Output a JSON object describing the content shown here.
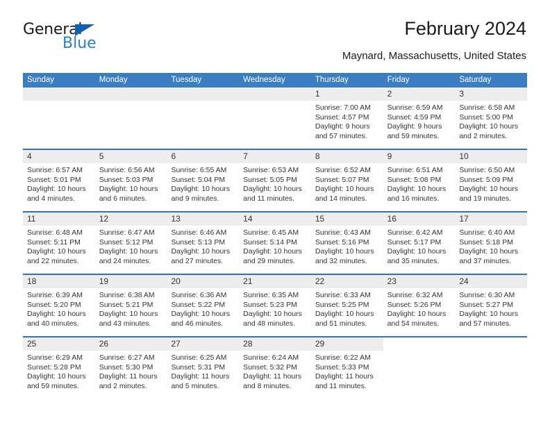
{
  "logo": {
    "word_one": "General",
    "word_two": "Blue",
    "triangle_color": "#1161ad",
    "blue_text_color": "#2a7fd4"
  },
  "header": {
    "title": "February 2024",
    "location": "Maynard, Massachusetts, United States"
  },
  "theme": {
    "header_blue": "#3a7dc0",
    "separator_blue": "#2f72b8",
    "daynum_band": "#ededed"
  },
  "weekdays": [
    "Sunday",
    "Monday",
    "Tuesday",
    "Wednesday",
    "Thursday",
    "Friday",
    "Saturday"
  ],
  "weeks": [
    [
      {
        "day": "",
        "empty": true
      },
      {
        "day": "",
        "empty": true
      },
      {
        "day": "",
        "empty": true
      },
      {
        "day": "",
        "empty": true
      },
      {
        "day": "1",
        "sunrise": "Sunrise: 7:00 AM",
        "sunset": "Sunset: 4:57 PM",
        "daylight": "Daylight: 9 hours and 57 minutes."
      },
      {
        "day": "2",
        "sunrise": "Sunrise: 6:59 AM",
        "sunset": "Sunset: 4:59 PM",
        "daylight": "Daylight: 9 hours and 59 minutes."
      },
      {
        "day": "3",
        "sunrise": "Sunrise: 6:58 AM",
        "sunset": "Sunset: 5:00 PM",
        "daylight": "Daylight: 10 hours and 2 minutes."
      }
    ],
    [
      {
        "day": "4",
        "sunrise": "Sunrise: 6:57 AM",
        "sunset": "Sunset: 5:01 PM",
        "daylight": "Daylight: 10 hours and 4 minutes."
      },
      {
        "day": "5",
        "sunrise": "Sunrise: 6:56 AM",
        "sunset": "Sunset: 5:03 PM",
        "daylight": "Daylight: 10 hours and 6 minutes."
      },
      {
        "day": "6",
        "sunrise": "Sunrise: 6:55 AM",
        "sunset": "Sunset: 5:04 PM",
        "daylight": "Daylight: 10 hours and 9 minutes."
      },
      {
        "day": "7",
        "sunrise": "Sunrise: 6:53 AM",
        "sunset": "Sunset: 5:05 PM",
        "daylight": "Daylight: 10 hours and 11 minutes."
      },
      {
        "day": "8",
        "sunrise": "Sunrise: 6:52 AM",
        "sunset": "Sunset: 5:07 PM",
        "daylight": "Daylight: 10 hours and 14 minutes."
      },
      {
        "day": "9",
        "sunrise": "Sunrise: 6:51 AM",
        "sunset": "Sunset: 5:08 PM",
        "daylight": "Daylight: 10 hours and 16 minutes."
      },
      {
        "day": "10",
        "sunrise": "Sunrise: 6:50 AM",
        "sunset": "Sunset: 5:09 PM",
        "daylight": "Daylight: 10 hours and 19 minutes."
      }
    ],
    [
      {
        "day": "11",
        "sunrise": "Sunrise: 6:48 AM",
        "sunset": "Sunset: 5:11 PM",
        "daylight": "Daylight: 10 hours and 22 minutes."
      },
      {
        "day": "12",
        "sunrise": "Sunrise: 6:47 AM",
        "sunset": "Sunset: 5:12 PM",
        "daylight": "Daylight: 10 hours and 24 minutes."
      },
      {
        "day": "13",
        "sunrise": "Sunrise: 6:46 AM",
        "sunset": "Sunset: 5:13 PM",
        "daylight": "Daylight: 10 hours and 27 minutes."
      },
      {
        "day": "14",
        "sunrise": "Sunrise: 6:45 AM",
        "sunset": "Sunset: 5:14 PM",
        "daylight": "Daylight: 10 hours and 29 minutes."
      },
      {
        "day": "15",
        "sunrise": "Sunrise: 6:43 AM",
        "sunset": "Sunset: 5:16 PM",
        "daylight": "Daylight: 10 hours and 32 minutes."
      },
      {
        "day": "16",
        "sunrise": "Sunrise: 6:42 AM",
        "sunset": "Sunset: 5:17 PM",
        "daylight": "Daylight: 10 hours and 35 minutes."
      },
      {
        "day": "17",
        "sunrise": "Sunrise: 6:40 AM",
        "sunset": "Sunset: 5:18 PM",
        "daylight": "Daylight: 10 hours and 37 minutes."
      }
    ],
    [
      {
        "day": "18",
        "sunrise": "Sunrise: 6:39 AM",
        "sunset": "Sunset: 5:20 PM",
        "daylight": "Daylight: 10 hours and 40 minutes."
      },
      {
        "day": "19",
        "sunrise": "Sunrise: 6:38 AM",
        "sunset": "Sunset: 5:21 PM",
        "daylight": "Daylight: 10 hours and 43 minutes."
      },
      {
        "day": "20",
        "sunrise": "Sunrise: 6:36 AM",
        "sunset": "Sunset: 5:22 PM",
        "daylight": "Daylight: 10 hours and 46 minutes."
      },
      {
        "day": "21",
        "sunrise": "Sunrise: 6:35 AM",
        "sunset": "Sunset: 5:23 PM",
        "daylight": "Daylight: 10 hours and 48 minutes."
      },
      {
        "day": "22",
        "sunrise": "Sunrise: 6:33 AM",
        "sunset": "Sunset: 5:25 PM",
        "daylight": "Daylight: 10 hours and 51 minutes."
      },
      {
        "day": "23",
        "sunrise": "Sunrise: 6:32 AM",
        "sunset": "Sunset: 5:26 PM",
        "daylight": "Daylight: 10 hours and 54 minutes."
      },
      {
        "day": "24",
        "sunrise": "Sunrise: 6:30 AM",
        "sunset": "Sunset: 5:27 PM",
        "daylight": "Daylight: 10 hours and 57 minutes."
      }
    ],
    [
      {
        "day": "25",
        "sunrise": "Sunrise: 6:29 AM",
        "sunset": "Sunset: 5:28 PM",
        "daylight": "Daylight: 10 hours and 59 minutes."
      },
      {
        "day": "26",
        "sunrise": "Sunrise: 6:27 AM",
        "sunset": "Sunset: 5:30 PM",
        "daylight": "Daylight: 11 hours and 2 minutes."
      },
      {
        "day": "27",
        "sunrise": "Sunrise: 6:25 AM",
        "sunset": "Sunset: 5:31 PM",
        "daylight": "Daylight: 11 hours and 5 minutes."
      },
      {
        "day": "28",
        "sunrise": "Sunrise: 6:24 AM",
        "sunset": "Sunset: 5:32 PM",
        "daylight": "Daylight: 11 hours and 8 minutes."
      },
      {
        "day": "29",
        "sunrise": "Sunrise: 6:22 AM",
        "sunset": "Sunset: 5:33 PM",
        "daylight": "Daylight: 11 hours and 11 minutes."
      },
      {
        "day": "",
        "blank": true
      },
      {
        "day": "",
        "blank": true
      }
    ]
  ]
}
